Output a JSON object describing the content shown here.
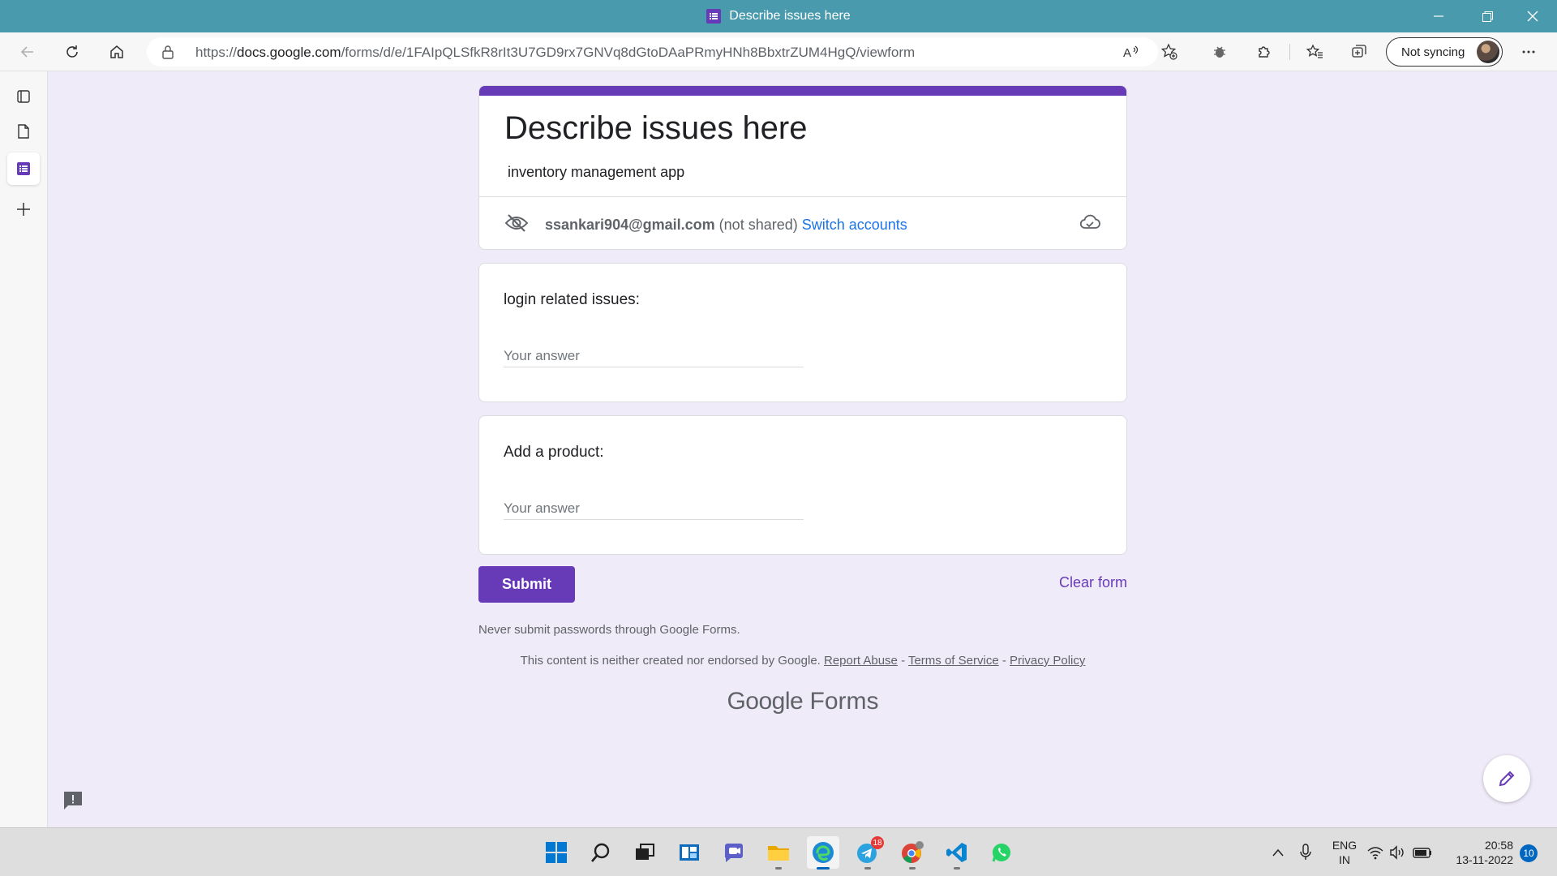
{
  "window": {
    "title": "Describe issues here"
  },
  "browser": {
    "url_prefix": "https://",
    "url_domain": "docs.google.com",
    "url_path": "/forms/d/e/1FAIpQLSfkR8rIt3U7GD9rx7GNVq8dGtoDAaPRmyHNh8BbxtrZUM4HgQ/viewform",
    "sync_label": "Not syncing"
  },
  "form": {
    "title": "Describe issues here",
    "description": "inventory management app",
    "account_email": "ssankari904@gmail.com",
    "account_note": "(not shared)",
    "switch_accounts": "Switch accounts",
    "questions": [
      {
        "label": "login related issues:",
        "placeholder": "Your answer"
      },
      {
        "label": "Add a product:",
        "placeholder": "Your answer"
      }
    ],
    "submit_label": "Submit",
    "clear_label": "Clear form",
    "warning": "Never submit passwords through Google Forms.",
    "disclaimer": "This content is neither created nor endorsed by Google.",
    "links": {
      "report_abuse": "Report Abuse",
      "terms": "Terms of Service",
      "privacy": "Privacy Policy"
    },
    "brand_google": "Google",
    "brand_forms": "Forms"
  },
  "taskbar": {
    "telegram_badge": "18",
    "lang_line1": "ENG",
    "lang_line2": "IN",
    "time": "20:58",
    "date": "13-11-2022",
    "notifications": "10"
  },
  "colors": {
    "accent": "#673ab7",
    "background": "#f0ebf8",
    "titlebar": "#4a9aad",
    "link": "#1a73e8"
  }
}
